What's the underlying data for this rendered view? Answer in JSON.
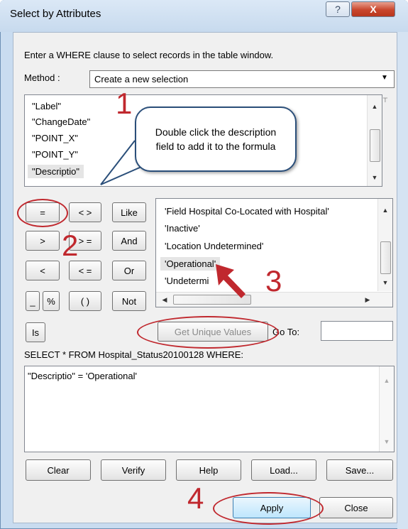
{
  "window": {
    "title": "Select by Attributes",
    "help_glyph": "?",
    "close_glyph": "X"
  },
  "instruction": "Enter a WHERE clause to select records in the table window.",
  "method": {
    "label": "Method :",
    "value": "Create a new selection"
  },
  "fields": [
    "\"Label\"",
    "\"ChangeDate\"",
    "\"POINT_X\"",
    "\"POINT_Y\"",
    "\"Descriptio\""
  ],
  "callout": {
    "text": "Double click the description field to add it to the formula"
  },
  "operators": {
    "eq": "=",
    "ne": "< >",
    "like": "Like",
    "gt": ">",
    "ge": "> =",
    "and": "And",
    "lt": "<",
    "le": "< =",
    "or": "Or",
    "underscore": "_",
    "percent": "%",
    "parens": "( )",
    "not": "Not",
    "is": "Is"
  },
  "values": [
    "'Field Hospital Co-Located with Hospital'",
    "'Inactive'",
    "'Location Undetermined'",
    "'Operational'",
    "'Undetermi"
  ],
  "unique_button": "Get Unique Values",
  "goto_label": "Go To:",
  "sql_prefix": "SELECT * FROM Hospital_Status20100128 WHERE:",
  "expression": "\"Descriptio\" = 'Operational'",
  "bottom_buttons": {
    "clear": "Clear",
    "verify": "Verify",
    "help": "Help",
    "load": "Load...",
    "save": "Save..."
  },
  "footer_buttons": {
    "apply": "Apply",
    "close": "Close"
  },
  "annotations": {
    "step1": "1",
    "step2": "2",
    "step3": "3",
    "step4": "4"
  },
  "colors": {
    "annotation_red": "#c0282e",
    "callout_border": "#2b4f7a"
  }
}
